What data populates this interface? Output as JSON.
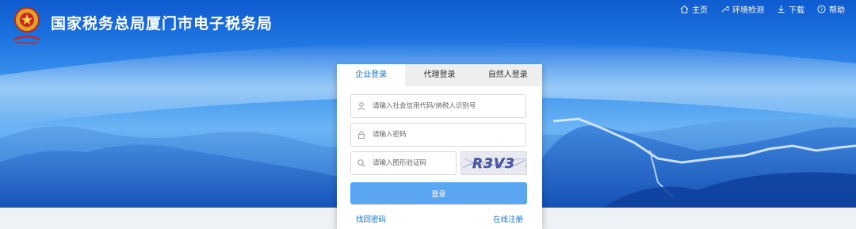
{
  "header": {
    "site_title": "国家税务总局厦门市电子税务局",
    "logo_icon": "tax-emblem-icon",
    "nav": [
      {
        "label": "主页",
        "icon": "home-icon"
      },
      {
        "label": "环境检测",
        "icon": "wrench-icon"
      },
      {
        "label": "下载",
        "icon": "download-icon"
      },
      {
        "label": "帮助",
        "icon": "help-icon"
      }
    ]
  },
  "login": {
    "tabs": [
      {
        "label": "企业登录",
        "active": true
      },
      {
        "label": "代理登录",
        "active": false
      },
      {
        "label": "自然人登录",
        "active": false
      }
    ],
    "account_placeholder": "请输入社会信用代码/纳税人识别号",
    "password_placeholder": "请输入密码",
    "captcha_placeholder": "请输入图形验证码",
    "captcha_text": "R3V3",
    "login_button": "登录",
    "forgot_password": "找回密码",
    "register": "在线注册"
  },
  "colors": {
    "accent": "#1a73d9",
    "button": "#5aa6f2",
    "banner_top": "#0f5bd0",
    "banner_sky": "#6cb4f5"
  }
}
